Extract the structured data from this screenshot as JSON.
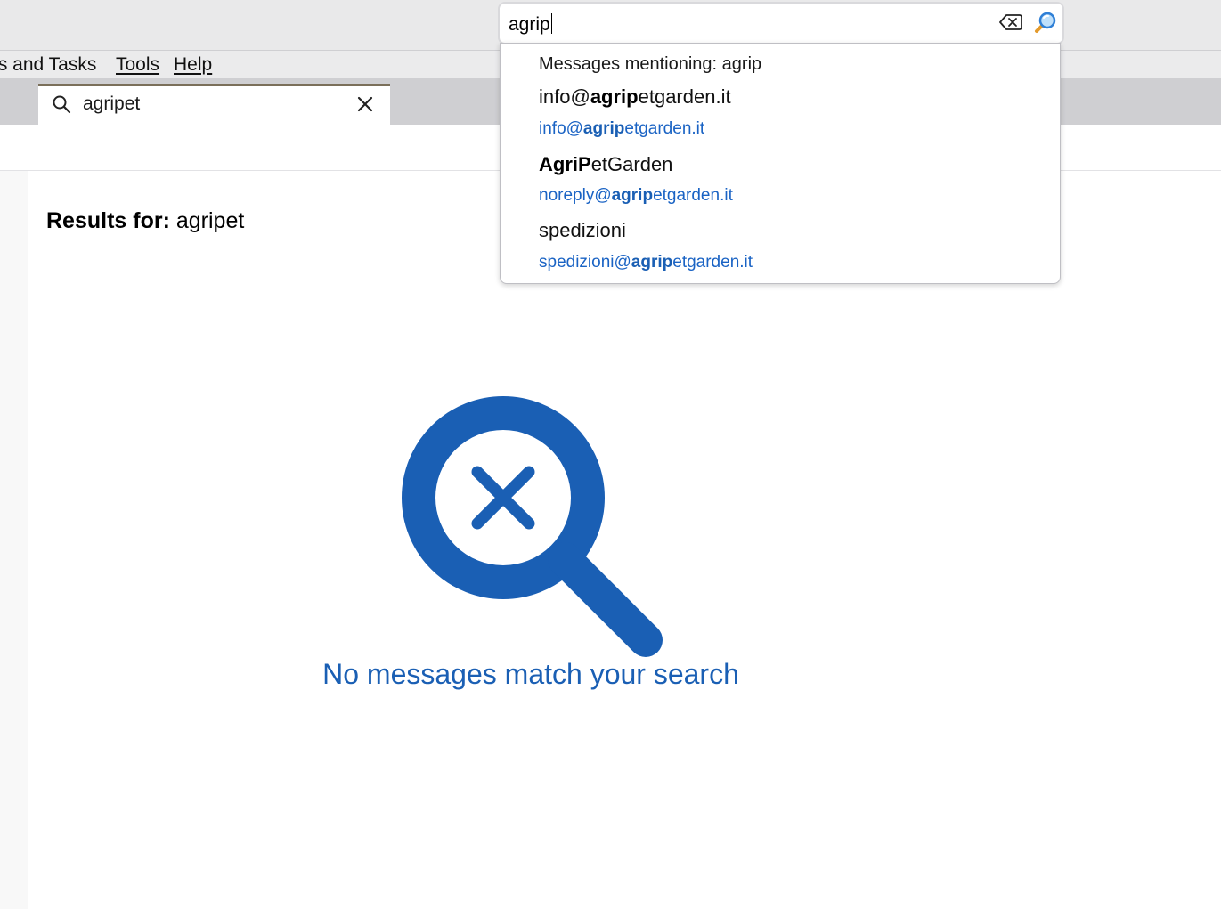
{
  "menubar": {
    "events_tasks": "ts and Tasks",
    "tools": "Tools",
    "help": "Help"
  },
  "tab": {
    "label": "agripet",
    "icon": "search-icon",
    "close_icon": "close-icon"
  },
  "results": {
    "prefix": "Results for:",
    "query": "agripet"
  },
  "empty_state": {
    "icon": "no-results-magnifier-icon",
    "message": "No messages match your search",
    "color": "#1a5fb4"
  },
  "global_search": {
    "value": "agrip",
    "clear_icon": "backspace-clear-icon",
    "go_icon": "magnifier-go-icon"
  },
  "suggestions": {
    "mentioning": "Messages mentioning: agrip",
    "items": [
      {
        "name_bold": "",
        "name_pre": "info@",
        "name_match": "agrip",
        "name_rest": "etgarden.it",
        "email_pre": "info@",
        "email_match": "agrip",
        "email_rest": "etgarden.it"
      },
      {
        "name_pre": "",
        "name_match": "AgriP",
        "name_rest": "etGarden",
        "email_pre": "noreply@",
        "email_match": "agrip",
        "email_rest": "etgarden.it"
      },
      {
        "name_pre": "spedizioni",
        "name_match": "",
        "name_rest": "",
        "email_pre": "spedizioni@",
        "email_match": "agrip",
        "email_rest": "etgarden.it"
      }
    ]
  },
  "colors": {
    "accent": "#1a5fb4",
    "link": "#1a63c4"
  }
}
